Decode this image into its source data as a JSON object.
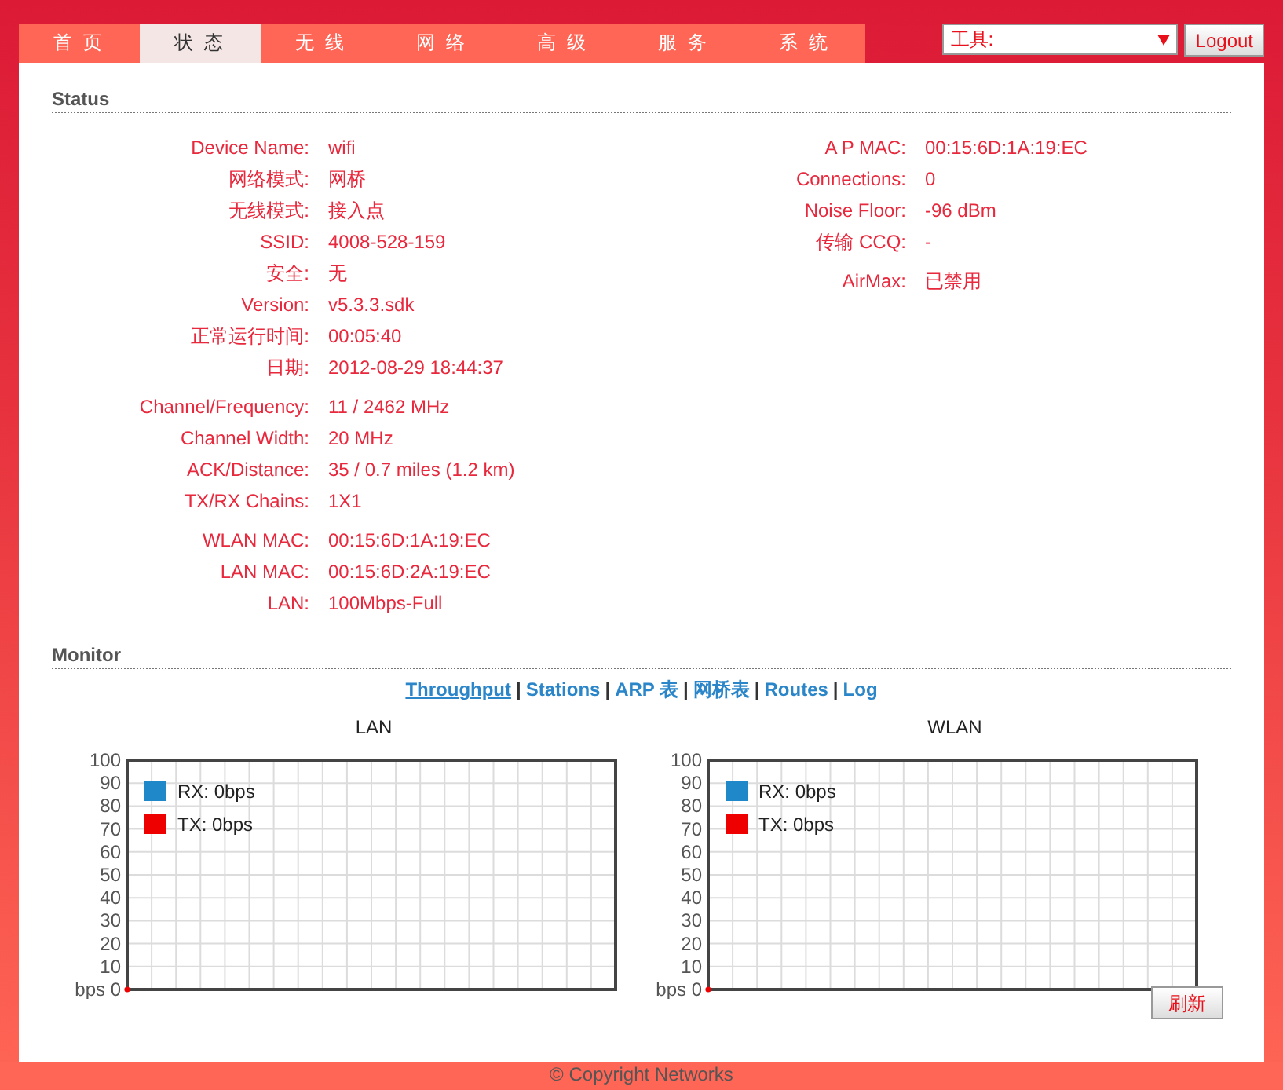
{
  "tabs": [
    {
      "label": "首 页",
      "selected": false
    },
    {
      "label": "状 态",
      "selected": true
    },
    {
      "label": "无 线",
      "selected": false
    },
    {
      "label": "网 络",
      "selected": false
    },
    {
      "label": "高 级",
      "selected": false
    },
    {
      "label": "服 务",
      "selected": false
    },
    {
      "label": "系 统",
      "selected": false
    }
  ],
  "tools_select": {
    "value": "工具:"
  },
  "logout_button": "Logout",
  "status": {
    "title": "Status",
    "left_groups": [
      [
        {
          "label": "Device Name:",
          "value": "wifi"
        },
        {
          "label": "网络模式:",
          "value": "网桥"
        },
        {
          "label": "无线模式:",
          "value": "接入点"
        },
        {
          "label": "SSID:",
          "value": "4008-528-159"
        },
        {
          "label": "安全:",
          "value": "无"
        },
        {
          "label": "Version:",
          "value": "v5.3.3.sdk"
        },
        {
          "label": "正常运行时间:",
          "value": "00:05:40"
        },
        {
          "label": "日期:",
          "value": "2012-08-29 18:44:37"
        }
      ],
      [
        {
          "label": "Channel/Frequency:",
          "value": "11 / 2462 MHz"
        },
        {
          "label": "Channel Width:",
          "value": "20 MHz"
        },
        {
          "label": "ACK/Distance:",
          "value": "35 / 0.7 miles (1.2 km)"
        },
        {
          "label": "TX/RX Chains:",
          "value": "1X1"
        }
      ],
      [
        {
          "label": "WLAN MAC:",
          "value": "00:15:6D:1A:19:EC"
        },
        {
          "label": "LAN MAC:",
          "value": "00:15:6D:2A:19:EC"
        },
        {
          "label": "LAN:",
          "value": "100Mbps-Full"
        }
      ]
    ],
    "right_groups": [
      [
        {
          "label": "A P MAC:",
          "value": "00:15:6D:1A:19:EC"
        },
        {
          "label": "Connections:",
          "value": "0"
        },
        {
          "label": "Noise Floor:",
          "value": "-96 dBm"
        },
        {
          "label": "传输 CCQ:",
          "value": "-"
        }
      ],
      [
        {
          "label": "AirMax:",
          "value": "已禁用"
        }
      ]
    ]
  },
  "monitor": {
    "title": "Monitor",
    "separator": "|",
    "links": [
      {
        "label": "Throughput",
        "selected": true
      },
      {
        "label": "Stations",
        "selected": false
      },
      {
        "label": "ARP 表",
        "selected": false
      },
      {
        "label": "网桥表",
        "selected": false
      },
      {
        "label": "Routes",
        "selected": false
      },
      {
        "label": "Log",
        "selected": false
      }
    ],
    "charts": [
      {
        "title": "LAN",
        "y_labels": [
          "100",
          "90",
          "80",
          "70",
          "60",
          "50",
          "40",
          "30",
          "20",
          "10",
          "bps 0"
        ],
        "legend": [
          {
            "label": "RX: 0bps",
            "color": "#1e88c8"
          },
          {
            "label": "TX: 0bps",
            "color": "#ee0000"
          }
        ]
      },
      {
        "title": "WLAN",
        "y_labels": [
          "100",
          "90",
          "80",
          "70",
          "60",
          "50",
          "40",
          "30",
          "20",
          "10",
          "bps 0"
        ],
        "legend": [
          {
            "label": "RX: 0bps",
            "color": "#1e88c8"
          },
          {
            "label": "TX: 0bps",
            "color": "#ee0000"
          }
        ]
      }
    ],
    "refresh_button": "刷新"
  },
  "footer": "© Copyright Networks"
}
